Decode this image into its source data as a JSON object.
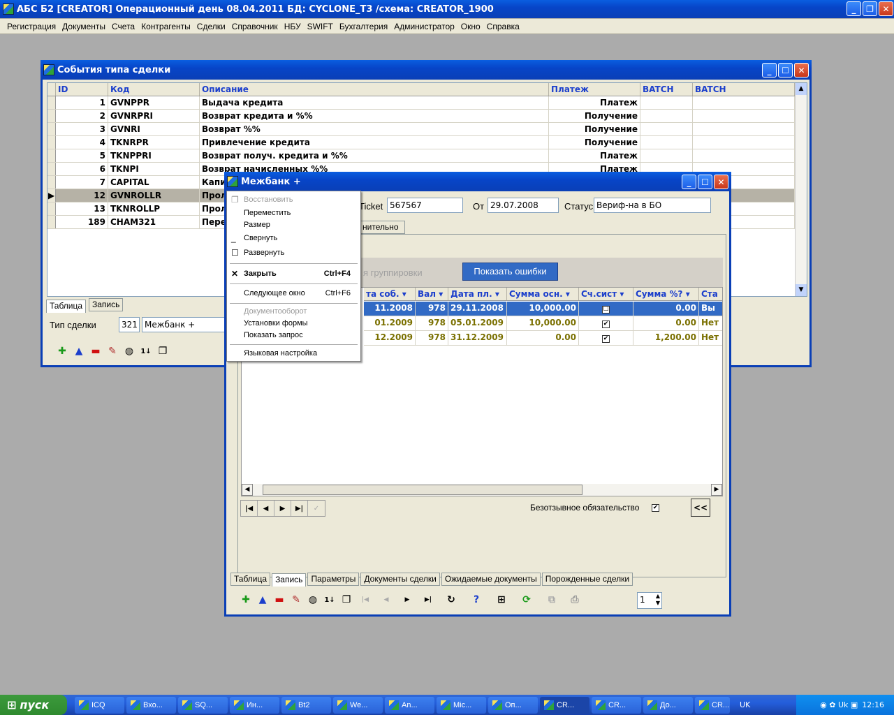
{
  "app": {
    "title": "АБС Б2 [CREATOR] Операционный день 08.04.2011 БД: CYCLONE_T3 /схема: CREATOR_1900",
    "menu": [
      "Регистрация",
      "Документы",
      "Счета",
      "Контрагенты",
      "Сделки",
      "Справочник",
      "НБУ",
      "SWIFT",
      "Бухгалтерия",
      "Администратор",
      "Окно",
      "Справка"
    ]
  },
  "events_window": {
    "title": "События типа сделки",
    "columns": [
      "ID",
      "Код",
      "Описание",
      "Платеж",
      "BATCH",
      "BATCH"
    ],
    "rows": [
      {
        "id": "1",
        "code": "GVNPPR",
        "desc": "Выдача кредита",
        "pay": "Платеж"
      },
      {
        "id": "2",
        "code": "GVNRPRI",
        "desc": "Возврат кредита и %%",
        "pay": "Получение"
      },
      {
        "id": "3",
        "code": "GVNRI",
        "desc": "Возврат %%",
        "pay": "Получение"
      },
      {
        "id": "4",
        "code": "TKNRPR",
        "desc": "Привлечение кредита",
        "pay": "Получение"
      },
      {
        "id": "5",
        "code": "TKNPPRI",
        "desc": "Возврат получ. кредита и %%",
        "pay": "Платеж"
      },
      {
        "id": "6",
        "code": "TKNPI",
        "desc": "Возврат начисленных %%",
        "pay": "Платеж"
      },
      {
        "id": "7",
        "code": "CAPITAL",
        "desc": "Капит",
        "pay": ""
      },
      {
        "id": "12",
        "code": "GVNROLLR",
        "desc": "Прол",
        "pay": ""
      },
      {
        "id": "13",
        "code": "TKNROLLP",
        "desc": "Прол",
        "pay": ""
      },
      {
        "id": "189",
        "code": "CHAM321",
        "desc": "Пере",
        "pay": ""
      }
    ],
    "tab_table": "Таблица",
    "tab_record": "Запись",
    "deal_type_label": "Тип сделки",
    "deal_type_code": "321",
    "deal_type_name": "Межбанк +"
  },
  "mb_window": {
    "title": "Межбанк +",
    "ticket_label": "Ticket",
    "ticket_value": "567567",
    "from_label": "От",
    "from_value": "29.07.2008",
    "status_label": "Статус",
    "status_value": "Вериф-на в БО",
    "tab_partial": "нительно",
    "grouping_text": "я группировки",
    "show_errors": "Показать ошибки",
    "grid_columns": [
      "та соб.",
      "Вал",
      "Дата пл.",
      "Сумма осн.",
      "Сч.сист",
      "Сумма %?",
      "Ста"
    ],
    "grid_rows": [
      {
        "d1": "11.2008",
        "cur": "978",
        "d2": "29.11.2008",
        "sum": "10,000.00",
        "chk": "☐",
        "sump": "0.00",
        "st": "Вы"
      },
      {
        "d1": "01.2009",
        "cur": "978",
        "d2": "05.01.2009",
        "sum": "10,000.00",
        "chk": "✔",
        "sump": "0.00",
        "st": "Нет"
      },
      {
        "d1": "12.2009",
        "cur": "978",
        "d2": "31.12.2009",
        "sum": "0.00",
        "chk": "✔",
        "sump": "1,200.00",
        "st": "Нет"
      }
    ],
    "irrevocable_label": "Безотзывное обязательство",
    "collapse_btn": "<<",
    "bottom_tabs": [
      "Таблица",
      "Запись",
      "Параметры",
      "Документы сделки",
      "Ожидаемые документы",
      "Порожденные сделки"
    ],
    "page_value": "1"
  },
  "context_menu": {
    "restore": "Восстановить",
    "move": "Переместить",
    "size": "Размер",
    "minimize": "Свернуть",
    "maximize": "Развернуть",
    "close": "Закрыть",
    "close_accel": "Ctrl+F4",
    "next": "Следующее окно",
    "next_accel": "Ctrl+F6",
    "docflow": "Документооборот",
    "form_settings": "Установки формы",
    "show_query": "Показать запрос",
    "lang": "Языковая настройка"
  },
  "taskbar": {
    "start": "пуск",
    "items": [
      "ICQ",
      "Вхо...",
      "SQ...",
      "Ин...",
      "Bt2",
      "We...",
      "An...",
      "Mic...",
      "Оп...",
      "CR...",
      "CR...",
      "До...",
      "CR..."
    ],
    "lang": "UK",
    "clock": "12:16"
  }
}
